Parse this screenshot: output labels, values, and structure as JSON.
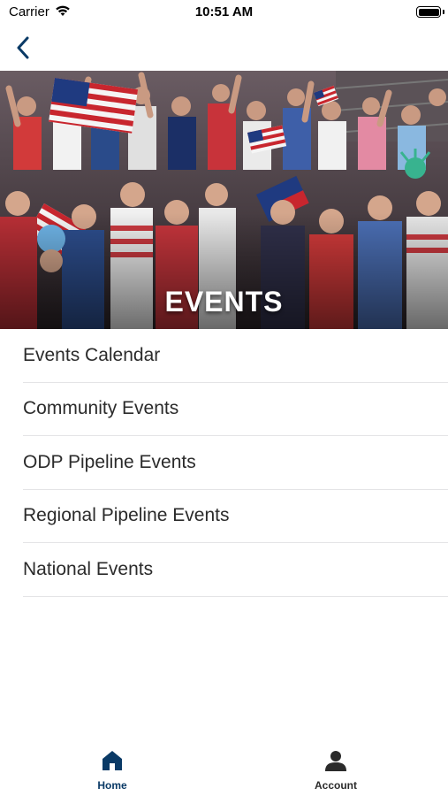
{
  "status_bar": {
    "carrier": "Carrier",
    "time": "10:51 AM"
  },
  "nav": {
    "back_icon": "chevron-left-icon"
  },
  "hero": {
    "title": "EVENTS",
    "image": "crowd of fans with american flags"
  },
  "events": {
    "items": [
      {
        "label": "Events Calendar"
      },
      {
        "label": "Community Events"
      },
      {
        "label": "ODP Pipeline Events"
      },
      {
        "label": "Regional Pipeline Events"
      },
      {
        "label": "National Events"
      }
    ]
  },
  "tab_bar": {
    "tabs": [
      {
        "label": "Home",
        "icon": "home-icon",
        "active": true
      },
      {
        "label": "Account",
        "icon": "person-icon",
        "active": false
      }
    ]
  },
  "colors": {
    "accent": "#0a3a66",
    "divider": "#e4e4e6",
    "text": "#2b2b2b"
  }
}
